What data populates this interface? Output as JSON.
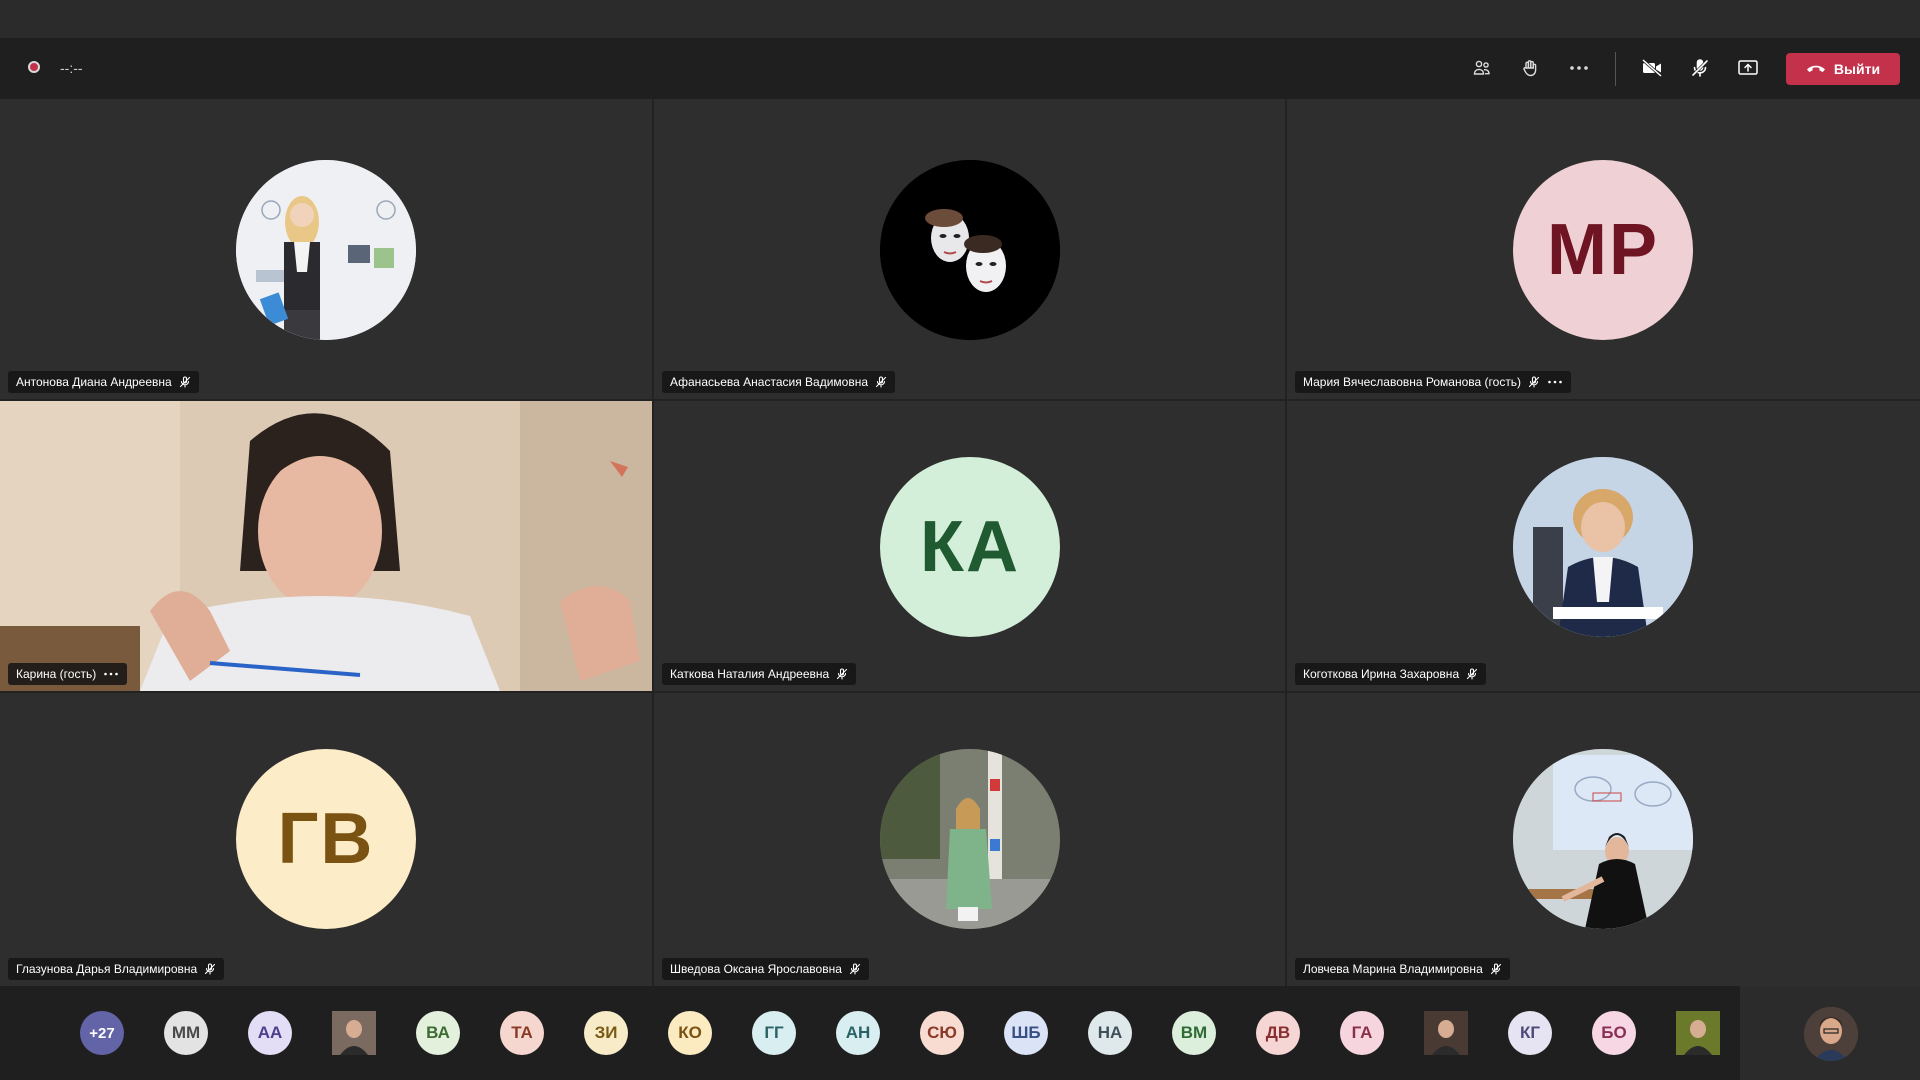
{
  "meeting": {
    "timer": "--:--",
    "leave_label": "Выйти"
  },
  "colors": {
    "leave_button": "#c4314b",
    "recording_dot": "#c4314b"
  },
  "toolbar": {
    "icons": [
      "participants-icon",
      "raise-hand-icon",
      "more-actions-icon",
      "camera-off-icon",
      "mic-off-icon",
      "share-screen-icon"
    ]
  },
  "tiles": [
    {
      "name": "Антонова Диана Андреевна",
      "avatar_type": "photo",
      "muted": true,
      "more": false
    },
    {
      "name": "Афанасьева Анастасия Вадимовна",
      "avatar_type": "photo",
      "muted": true,
      "more": false
    },
    {
      "name": "Мария Вячеславовна Романова (гость)",
      "avatar_type": "initials",
      "initials": "МР",
      "bg": "#efd0d4",
      "fg": "#6e1423",
      "muted": true,
      "more": true
    },
    {
      "name": "Карина (гость)",
      "avatar_type": "video",
      "muted": false,
      "more": true
    },
    {
      "name": "Каткова Наталия Андреевна",
      "avatar_type": "initials",
      "initials": "КА",
      "bg": "#d3eed9",
      "fg": "#1f5a30",
      "muted": true,
      "more": false
    },
    {
      "name": "Коготкова Ирина Захаровна",
      "avatar_type": "photo",
      "muted": true,
      "more": false
    },
    {
      "name": "Глазунова Дарья Владимировна",
      "avatar_type": "initials",
      "initials": "ГВ",
      "bg": "#fcecc7",
      "fg": "#7a5212",
      "muted": true,
      "more": false
    },
    {
      "name": "Шведова Оксана Ярославовна",
      "avatar_type": "photo",
      "muted": true,
      "more": false
    },
    {
      "name": "Ловчева Марина Владимировна",
      "avatar_type": "photo",
      "muted": true,
      "more": false
    }
  ],
  "bottom_bar": {
    "overflow_label": "+27",
    "chips": [
      {
        "label": "ММ",
        "bg": "#e3e3e3",
        "fg": "#4a4a4a"
      },
      {
        "label": "АА",
        "bg": "#e3ddf5",
        "fg": "#4d3f8c"
      },
      {
        "label": "",
        "bg": "#7a6a60",
        "fg": "#ffffff",
        "photo": true
      },
      {
        "label": "ВА",
        "bg": "#e2f0dc",
        "fg": "#3d6b33"
      },
      {
        "label": "ТА",
        "bg": "#f6d7cf",
        "fg": "#8a3a27"
      },
      {
        "label": "ЗИ",
        "bg": "#f8ecc8",
        "fg": "#7a5a12"
      },
      {
        "label": "КО",
        "bg": "#fcebc0",
        "fg": "#7a5212"
      },
      {
        "label": "ГГ",
        "bg": "#d9eef0",
        "fg": "#2a6268"
      },
      {
        "label": "АН",
        "bg": "#d9eef0",
        "fg": "#2a6268"
      },
      {
        "label": "СЮ",
        "bg": "#f8dcd2",
        "fg": "#8a3a27"
      },
      {
        "label": "ШБ",
        "bg": "#dbe4f6",
        "fg": "#3a4f86"
      },
      {
        "label": "НА",
        "bg": "#dfe8ea",
        "fg": "#3d5258"
      },
      {
        "label": "ВМ",
        "bg": "#dcefdc",
        "fg": "#2f6b35"
      },
      {
        "label": "ДВ",
        "bg": "#f6d5d5",
        "fg": "#8a2f2f"
      },
      {
        "label": "ГА",
        "bg": "#f6d5de",
        "fg": "#8a2f4a"
      },
      {
        "label": "",
        "bg": "#4a3a34",
        "fg": "#ffffff",
        "photo": true
      },
      {
        "label": "КГ",
        "bg": "#e6e3f2",
        "fg": "#4d4a7a"
      },
      {
        "label": "БО",
        "bg": "#f6d7e3",
        "fg": "#8a2f55"
      },
      {
        "label": "",
        "bg": "#6b7a2a",
        "fg": "#ffffff",
        "photo": true
      }
    ]
  }
}
